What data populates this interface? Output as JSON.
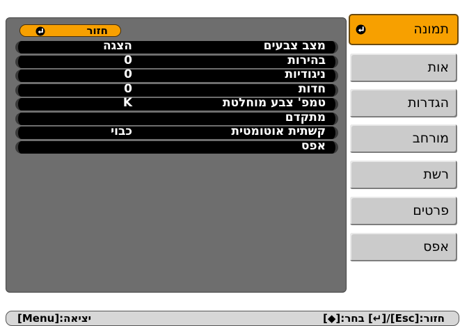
{
  "sidebar": {
    "items": [
      {
        "label": "תמונה",
        "active": true
      },
      {
        "label": "אות"
      },
      {
        "label": "הגדרות"
      },
      {
        "label": "מורחב"
      },
      {
        "label": "רשת"
      },
      {
        "label": "פרטים"
      },
      {
        "label": "אפס"
      }
    ],
    "active_color": "#f7a000"
  },
  "panel": {
    "back_label": "חזור",
    "rows": [
      {
        "name": "מצב צבעים",
        "value": "הצגה"
      },
      {
        "name": "בהירות",
        "value": "0"
      },
      {
        "name": "ניגודיות",
        "value": "0"
      },
      {
        "name": "חדות",
        "value": "0"
      },
      {
        "name": "טמפ' צבע מוחלטת",
        "value": "K"
      },
      {
        "name": "מתקדם",
        "value": ""
      },
      {
        "name": "קשתית אוטומטית",
        "value": "כבוי"
      },
      {
        "name": "אפס",
        "value": ""
      }
    ]
  },
  "status_bar": {
    "exit_text": "[Menu]:יציאה",
    "select_text": "[◆]:בחר",
    "back_text": "[↵]/[Esc]:חזור"
  }
}
